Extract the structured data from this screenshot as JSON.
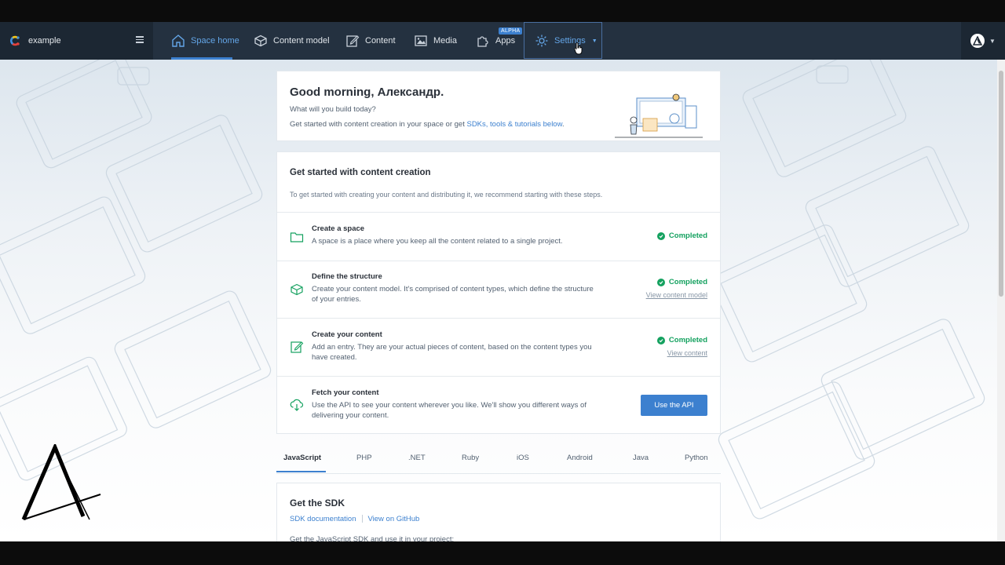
{
  "space": {
    "name": "example"
  },
  "nav": {
    "items": [
      {
        "label": "Space home"
      },
      {
        "label": "Content model"
      },
      {
        "label": "Content"
      },
      {
        "label": "Media"
      },
      {
        "label": "Apps",
        "badge": "ALPHA"
      },
      {
        "label": "Settings"
      }
    ]
  },
  "welcome": {
    "title": "Good morning, Александр.",
    "subtitle": "What will you build today?",
    "line_prefix": "Get started with content creation in your space or get ",
    "line_link": "SDKs, tools & tutorials below",
    "line_suffix": "."
  },
  "getting_started": {
    "title": "Get started with content creation",
    "description": "To get started with creating your content and distributing it, we recommend starting with these steps.",
    "steps": [
      {
        "title": "Create a space",
        "description": "A space is a place where you keep all the content related to a single project.",
        "status": "Completed",
        "icon": "folder-icon"
      },
      {
        "title": "Define the structure",
        "description": "Create your content model. It's comprised of content types, which define the structure of your entries.",
        "status": "Completed",
        "link": "View content model",
        "icon": "box-icon"
      },
      {
        "title": "Create your content",
        "description": "Add an entry. They are your actual pieces of content, based on the content types you have created.",
        "status": "Completed",
        "link": "View content",
        "icon": "edit-icon"
      },
      {
        "title": "Fetch your content",
        "description": "Use the API to see your content wherever you like. We'll show you different ways of delivering your content.",
        "button": "Use the API",
        "icon": "cloud-download-icon"
      }
    ]
  },
  "languages": {
    "tabs": [
      "JavaScript",
      "PHP",
      ".NET",
      "Ruby",
      "iOS",
      "Android",
      "Java",
      "Python"
    ],
    "active": "JavaScript"
  },
  "sdk": {
    "title": "Get the SDK",
    "link_docs": "SDK documentation",
    "link_github": "View on GitHub",
    "description": "Get the JavaScript SDK and use it in your project:"
  },
  "colors": {
    "nav_bg": "#243140",
    "accent": "#3c80cf",
    "success": "#14a15f"
  }
}
